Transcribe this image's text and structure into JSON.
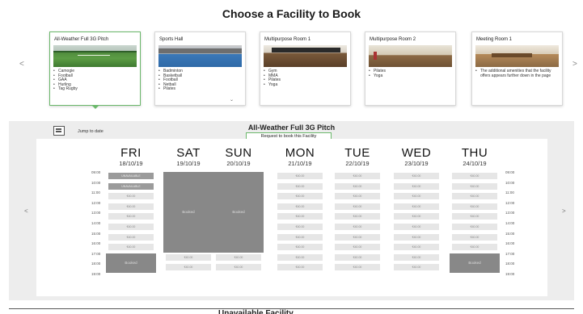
{
  "page_title": "Choose a Facility to Book",
  "carousel": {
    "prev_arrow": "<",
    "next_arrow": ">",
    "cards": [
      {
        "title": "All-Weather Full 3G Pitch",
        "selected": true,
        "items": [
          "Camogie",
          "Football",
          "GAA",
          "Hurling",
          "Tag Rugby"
        ]
      },
      {
        "title": "Sports Hall",
        "selected": false,
        "items": [
          "Badminton",
          "Basketball",
          "Football",
          "Netball",
          "Pilates"
        ]
      },
      {
        "title": "Multipurpose Room 1",
        "selected": false,
        "items": [
          "Gym",
          "MMA",
          "Pilates",
          "Yoga"
        ]
      },
      {
        "title": "Multipurpose Room 2",
        "selected": false,
        "items": [
          "Pilates",
          "Yoga"
        ]
      },
      {
        "title": "Meeting Room 1",
        "selected": false,
        "items": [
          "The additional amenities that the facility offers appears further down in the page"
        ]
      }
    ]
  },
  "schedule": {
    "jump_to_date": "Jump to date",
    "facility_title": "All-Weather Full 3G Pitch",
    "request_button": "Request to book this Facility",
    "prev_arrow": "<",
    "next_arrow": ">",
    "days": [
      {
        "name": "FRI",
        "date": "18/10/19"
      },
      {
        "name": "SAT",
        "date": "19/10/19"
      },
      {
        "name": "SUN",
        "date": "20/10/19"
      },
      {
        "name": "MON",
        "date": "21/10/19"
      },
      {
        "name": "TUE",
        "date": "22/10/19"
      },
      {
        "name": "WED",
        "date": "23/10/19"
      },
      {
        "name": "THU",
        "date": "24/10/19"
      }
    ],
    "times": [
      "09:00",
      "10:00",
      "11:00",
      "12:00",
      "13:00",
      "14:00",
      "15:00",
      "16:00",
      "17:00",
      "18:00",
      "19:00"
    ],
    "booked_label": "Booked",
    "unavailable_label": "UNAVAILABLE",
    "price_label": "€40.00"
  },
  "bottom_heading": "Unavailable Facility"
}
